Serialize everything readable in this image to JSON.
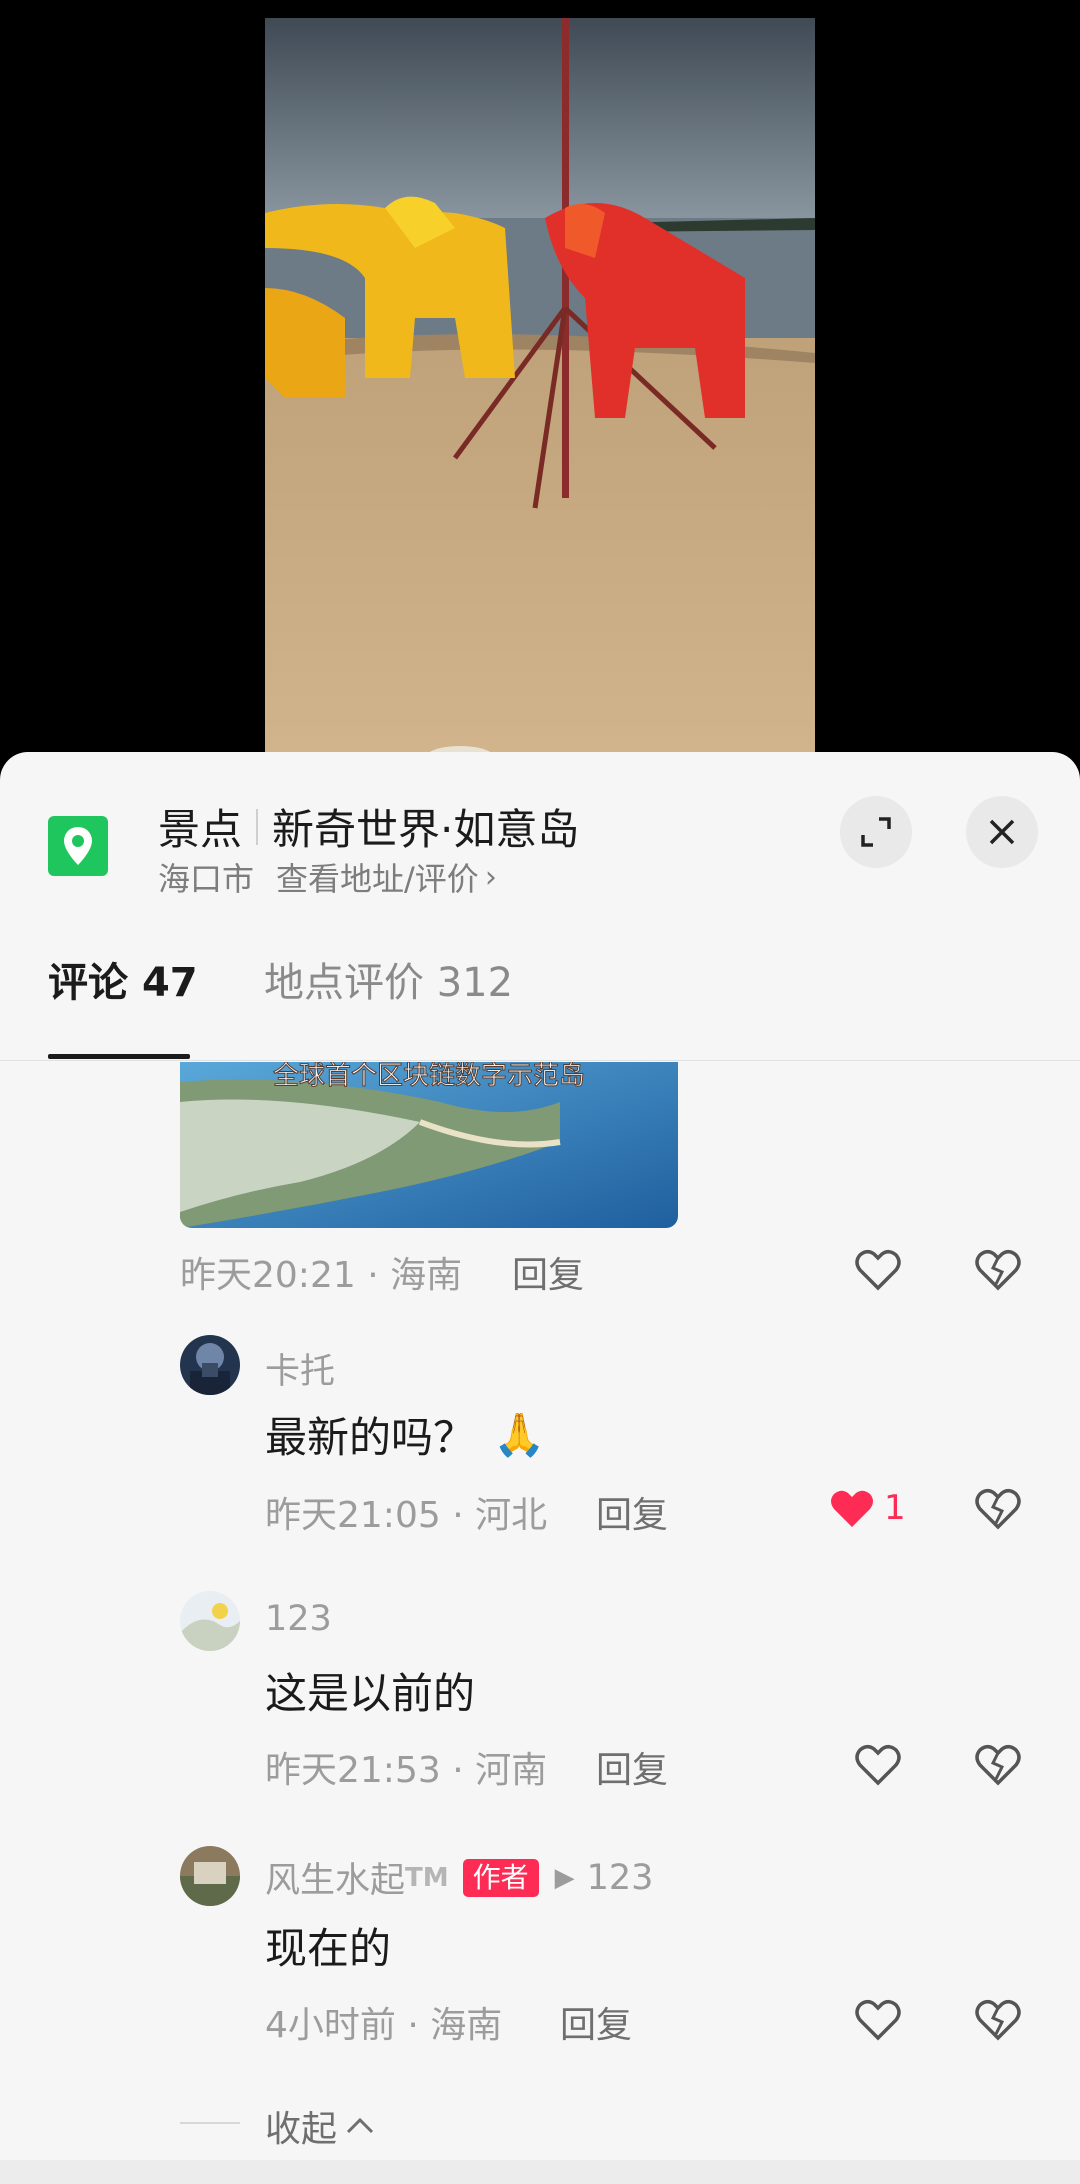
{
  "video": {
    "description_icon": "lion-dance-beach-video"
  },
  "place": {
    "category": "景点",
    "name": "新奇世界·如意岛",
    "city": "海口市",
    "link": "查看地址/评价",
    "link_chevron": "›"
  },
  "buttons": {
    "expand_icon": "expand-icon",
    "close_icon": "close-icon"
  },
  "tabs": {
    "comments_label": "评论",
    "comments_count": "47",
    "reviews_label": "地点评价",
    "reviews_count": "312"
  },
  "comments": [
    {
      "image_caption": "全球首个区块链数字示范岛",
      "time": "昨天20:21",
      "location": "海南",
      "reply": "回复"
    },
    {
      "user": "卡托",
      "text": "最新的吗？",
      "emoji": "🙏",
      "time": "昨天21:05",
      "location": "河北",
      "reply": "回复",
      "likes": "1"
    },
    {
      "user": "123",
      "text": "这是以前的",
      "time": "昨天21:53",
      "location": "河南",
      "reply": "回复"
    },
    {
      "user": "风生水起",
      "user_suffix": "TM",
      "badge": "作者",
      "reply_to": "123",
      "text": "现在的",
      "time": "4小时前",
      "location": "海南",
      "reply": "回复"
    }
  ],
  "collapse_label": "收起",
  "colors": {
    "accent": "#fe2c55",
    "pin": "#1fc65e"
  }
}
